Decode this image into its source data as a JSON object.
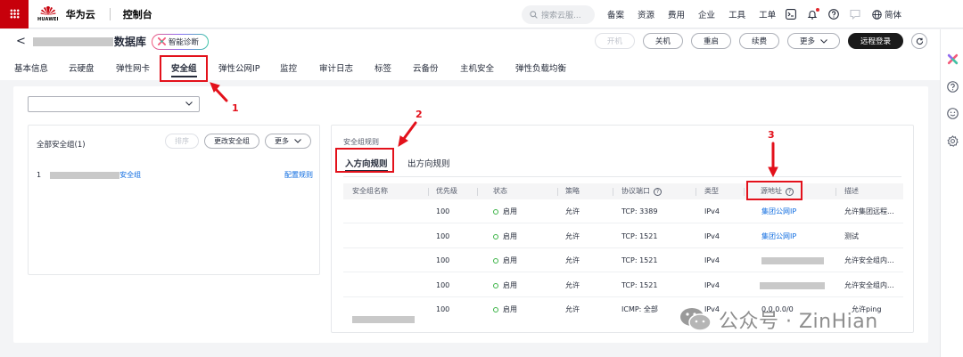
{
  "topbar": {
    "brand": "华为云",
    "logo_text": "HUAWEI",
    "console": "控制台",
    "search_placeholder": "搜索云服...",
    "nav": [
      "备案",
      "资源",
      "费用",
      "企业",
      "工具",
      "工单"
    ],
    "language": "简体"
  },
  "titlebar": {
    "back": "<",
    "db_suffix": "数据库",
    "diagnose": "智能诊断",
    "actions": {
      "power_on": "开机",
      "power_off": "关机",
      "restart": "重启",
      "renew": "续费",
      "more": "更多",
      "remote_login": "远程登录"
    }
  },
  "tabs": [
    "基本信息",
    "云硬盘",
    "弹性网卡",
    "安全组",
    "弹性公网IP",
    "监控",
    "审计日志",
    "标签",
    "云备份",
    "主机安全",
    "弹性负载均衡"
  ],
  "active_tab": "安全组",
  "left_panel": {
    "title": "全部安全组(1)",
    "btn_sort": "排序",
    "btn_change": "更改安全组",
    "btn_more": "更多",
    "row_index": "1",
    "row_suffix": "安全组",
    "row_config": "配置规则"
  },
  "right_panel": {
    "label": "安全组规则",
    "tab_inbound": "入方向规则",
    "tab_outbound": "出方向规则",
    "headers": [
      "安全组名称",
      "优先级",
      "状态",
      "策略",
      "协议端口",
      "类型",
      "源地址",
      "描述"
    ],
    "rows": [
      {
        "priority": "100",
        "status": "启用",
        "policy": "允许",
        "port": "TCP: 3389",
        "type": "IPv4",
        "source": "集团公网IP",
        "desc": "允许集团远程..."
      },
      {
        "priority": "100",
        "status": "启用",
        "policy": "允许",
        "port": "TCP: 1521",
        "type": "IPv4",
        "source": "集团公网IP",
        "desc": "测试"
      },
      {
        "priority": "100",
        "status": "启用",
        "policy": "允许",
        "port": "TCP: 1521",
        "type": "IPv4",
        "source": "",
        "desc": "允许安全组内..."
      },
      {
        "priority": "100",
        "status": "启用",
        "policy": "允许",
        "port": "TCP: 1521",
        "type": "IPv4",
        "source": "",
        "desc": "允许安全组内..."
      },
      {
        "priority": "100",
        "status": "启用",
        "policy": "允许",
        "port": "ICMP: 全部",
        "type": "IPv4",
        "source": "0.0.0.0/0",
        "desc": "允许ping"
      }
    ]
  },
  "annotations": [
    "1",
    "2",
    "3"
  ],
  "watermark": "公众号 · ZinHian",
  "colors": {
    "brand_red": "#c7000b",
    "annotation_red": "#e3111b",
    "link_blue": "#0d6be0",
    "status_green": "#3bb346"
  }
}
